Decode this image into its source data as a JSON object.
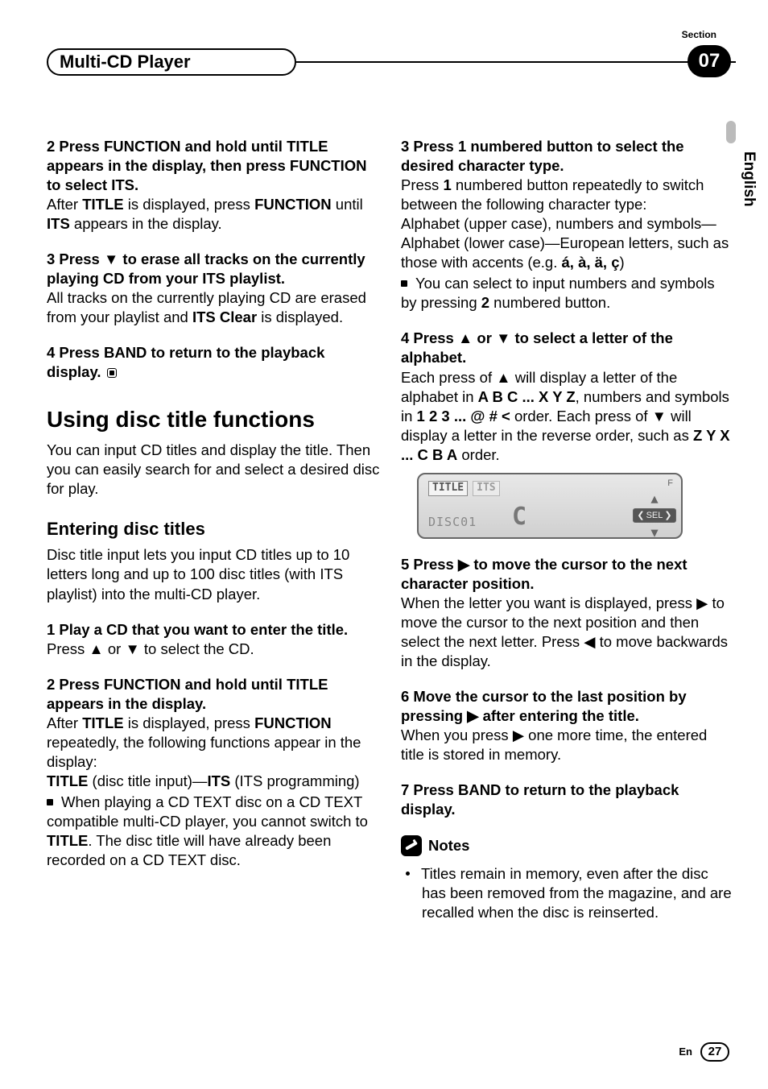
{
  "header": {
    "chapter": "Multi-CD Player",
    "section_label": "Section",
    "section_number": "07"
  },
  "side": {
    "language": "English"
  },
  "left": {
    "step2_head": "2    Press FUNCTION and hold until TITLE appears in the display, then press FUNCTION to select ITS.",
    "step2_body_a": "After ",
    "step2_body_b": "TITLE",
    "step2_body_c": " is displayed, press ",
    "step2_body_d": "FUNCTION",
    "step2_body_e": " until ",
    "step2_body_f": "ITS",
    "step2_body_g": " appears in the display.",
    "step3_head": "3    Press ▼ to erase all tracks on the currently playing CD from your ITS playlist.",
    "step3_body_a": "All tracks on the currently playing CD are erased from your playlist and ",
    "step3_body_b": "ITS Clear",
    "step3_body_c": " is displayed.",
    "step4_head": "4    Press BAND to return to the playback display.",
    "h1": "Using disc title functions",
    "h1_body": "You can input CD titles and display the title. Then you can easily search for and select a desired disc for play.",
    "h2": "Entering disc titles",
    "h2_body": "Disc title input lets you input CD titles up to 10 letters long and up to 100 disc titles (with ITS playlist) into the multi-CD player.",
    "b_step1_head": "1    Play a CD that you want to enter the title.",
    "b_step1_body": "Press ▲ or ▼ to select the CD.",
    "b_step2_head": "2    Press FUNCTION and hold until TITLE appears in the display.",
    "b_step2_body_a": "After ",
    "b_step2_body_b": "TITLE",
    "b_step2_body_c": " is displayed, press ",
    "b_step2_body_d": "FUNCTION",
    "b_step2_body_e": " repeatedly, the following functions appear in the display:",
    "b_step2_body_f": "TITLE",
    "b_step2_body_g": " (disc title input)—",
    "b_step2_body_h": "ITS",
    "b_step2_body_i": " (ITS programming)",
    "b_step2_bullet_a": "When playing a CD TEXT disc on a CD TEXT compatible multi-CD player, you cannot switch to ",
    "b_step2_bullet_b": "TITLE",
    "b_step2_bullet_c": ". The disc title will have already been recorded on a CD TEXT disc."
  },
  "right": {
    "step3_head": "3    Press 1 numbered button to select the desired character type.",
    "step3_body_a": "Press ",
    "step3_body_b": "1",
    "step3_body_c": " numbered button repeatedly to switch between the following character type:",
    "step3_body_d": "Alphabet (upper case), numbers and symbols—Alphabet (lower case)—European letters, such as those with accents (e.g. ",
    "step3_body_e": "á, à, ä, ç",
    "step3_body_f": ")",
    "step3_bullet_a": "You can select to input numbers and symbols by pressing ",
    "step3_bullet_b": "2",
    "step3_bullet_c": " numbered button.",
    "step4_head": "4    Press ▲ or ▼ to select a letter of the alphabet.",
    "step4_body_a": "Each press of ▲ will display a letter of the alphabet in ",
    "step4_body_b": "A B C ... X Y Z",
    "step4_body_c": ", numbers and symbols in ",
    "step4_body_d": "1 2 3 ... @ # <",
    "step4_body_e": " order. Each press of ▼ will display a letter in the reverse order, such as ",
    "step4_body_f": "Z Y X ... C B A",
    "step4_body_g": " order.",
    "display": {
      "tag1": "TITLE",
      "tag2": "ITS",
      "disc": "DISC01",
      "char": "C",
      "sel": "SEL",
      "f": "F"
    },
    "step5_head": "5    Press ▶ to move the cursor to the next character position.",
    "step5_body": "When the letter you want is displayed, press ▶ to move the cursor to the next position and then select the next letter. Press ◀ to move backwards in the display.",
    "step6_head": "6    Move the cursor to the last position by pressing ▶ after entering the title.",
    "step6_body": "When you press ▶ one more time, the entered title is stored in memory.",
    "step7_head": "7    Press BAND to return to the playback display.",
    "notes_label": "Notes",
    "note1": "Titles remain in memory, even after the disc has been removed from the magazine, and are recalled when the disc is reinserted."
  },
  "footer": {
    "lang": "En",
    "page": "27"
  }
}
